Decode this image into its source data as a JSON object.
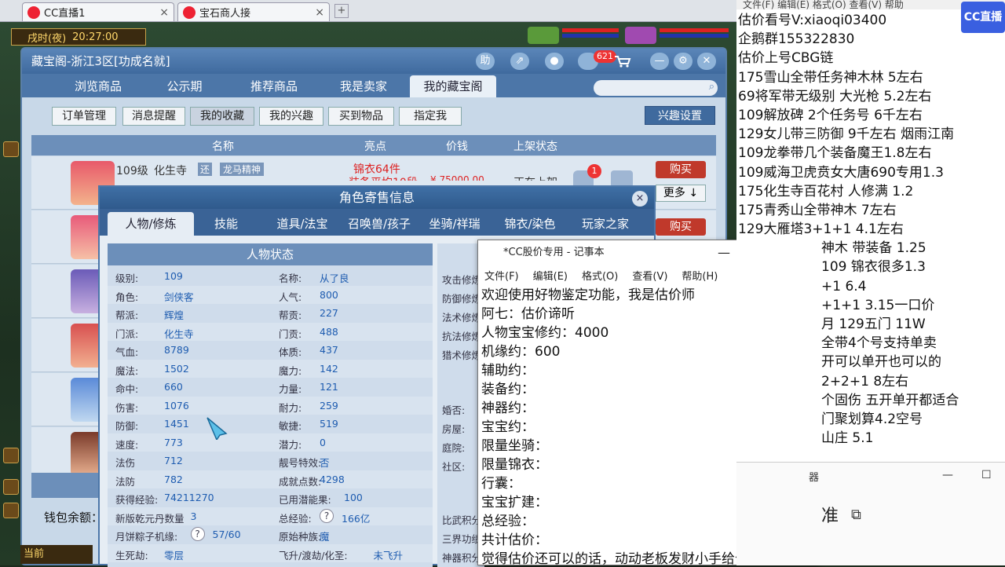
{
  "browser": {
    "tabs": [
      {
        "label": "CC直播1",
        "close": "×"
      },
      {
        "label": "宝石商人接",
        "close": "×"
      }
    ],
    "new_tab": "+"
  },
  "game": {
    "time_label": "戌时(夜)",
    "clock": "20:27:00",
    "bottom_label": "当前"
  },
  "treasure_window": {
    "title": "藏宝阁-浙江3区[功成名就]",
    "title_buttons": [
      "助",
      "⇗",
      "●"
    ],
    "message_badge": "621",
    "tabs": [
      "浏览商品",
      "公示期",
      "推荐商品",
      "我是卖家",
      "我的藏宝阁"
    ],
    "sub_buttons": [
      "订单管理",
      "消息提醒",
      "我的收藏",
      "我的兴趣",
      "买到物品",
      "指定我"
    ],
    "interest_button": "兴趣设置",
    "list_headers": [
      "名称",
      "亮点",
      "价钱",
      "上架状态"
    ],
    "first_row": {
      "level": "109级",
      "school": "化生寺",
      "tag1": "还",
      "tag2": "龙马精神",
      "highlight": "锦衣64件",
      "highlight2": "装备平均10段",
      "price": "¥ 75000.00",
      "status": "正在上架",
      "badge": "1"
    },
    "buy_label": "购买",
    "more_label": "更多 ↓",
    "wallet_label": "钱包余额："
  },
  "char_dialog": {
    "title": "角色寄售信息",
    "close": "×",
    "tabs": [
      "人物/修炼",
      "技能",
      "道具/法宝",
      "召唤兽/孩子",
      "坐骑/祥瑞",
      "锦衣/染色",
      "玩家之家"
    ],
    "stat_title": "人物状态",
    "stats": [
      [
        {
          "label": "级别:",
          "value": "109"
        },
        {
          "label": "名称:",
          "value": "从了良"
        }
      ],
      [
        {
          "label": "角色:",
          "value": "剑侠客"
        },
        {
          "label": "人气:",
          "value": "800"
        }
      ],
      [
        {
          "label": "帮派:",
          "value": "辉煌"
        },
        {
          "label": "帮贡:",
          "value": "227"
        }
      ],
      [
        {
          "label": "门派:",
          "value": "化生寺"
        },
        {
          "label": "门贡:",
          "value": "488"
        }
      ],
      [
        {
          "label": "气血:",
          "value": "8789"
        },
        {
          "label": "体质:",
          "value": "437"
        }
      ],
      [
        {
          "label": "魔法:",
          "value": "1502"
        },
        {
          "label": "魔力:",
          "value": "142"
        }
      ],
      [
        {
          "label": "命中:",
          "value": "660"
        },
        {
          "label": "力量:",
          "value": "121"
        }
      ],
      [
        {
          "label": "伤害:",
          "value": "1076"
        },
        {
          "label": "耐力:",
          "value": "259"
        }
      ],
      [
        {
          "label": "防御:",
          "value": "1451"
        },
        {
          "label": "敏捷:",
          "value": "519"
        }
      ],
      [
        {
          "label": "速度:",
          "value": "773"
        },
        {
          "label": "潜力:",
          "value": "0"
        }
      ],
      [
        {
          "label": "法伤",
          "value": "712"
        },
        {
          "label": "靓号特效:",
          "value": "否"
        }
      ],
      [
        {
          "label": "法防",
          "value": "782"
        },
        {
          "label": "成就点数:",
          "value": "4298"
        }
      ],
      [
        {
          "label": "获得经验:",
          "value": "74211270"
        },
        {
          "label": "已用潜能果:",
          "value": "100"
        }
      ],
      [
        {
          "label": "新版乾元丹数量",
          "value": "3"
        },
        {
          "label": "总经验:",
          "value": "166亿"
        }
      ],
      [
        {
          "label": "月饼粽子机缘:",
          "value": "57/60"
        },
        {
          "label": "原始种族:",
          "value": "魔"
        }
      ],
      [
        {
          "label": "生死劫:",
          "value": "零层"
        },
        {
          "label": "飞升/渡劫/化圣:",
          "value": "未飞升"
        }
      ]
    ],
    "side_labels": [
      "攻击修炼",
      "防御修炼",
      "法术修炼",
      "抗法修炼",
      "猎术修炼",
      "婚否:",
      "房屋:",
      "庭院:",
      "社区:",
      "比武积分",
      "三界功绩",
      "神器积分"
    ]
  },
  "notepad": {
    "title": "*CC股价专用 - 记事本",
    "min": "—",
    "max": "☐",
    "close": "✕",
    "menu": [
      "文件(F)",
      "编辑(E)",
      "格式(O)",
      "查看(V)",
      "帮助(H)"
    ],
    "lines": [
      "欢迎使用好物鉴定功能，我是估价师",
      "阿七：估价谛听",
      "人物宝宝修约：4000",
      "机缘约：600",
      "辅助约：",
      "装备约：",
      "神器约：",
      "宝宝约：",
      "限量坐骑：",
      "限量锦衣：",
      "行囊：",
      "宝宝扩建：",
      "总经验：",
      "共计估价：",
      "觉得估价还可以的话，动动老板发财小手给个好评"
    ]
  },
  "right_panel": {
    "menu_partial": "文件(F)   编辑(E)   格式(O)   查看(V)   帮助",
    "logo": "CC直播",
    "lines": [
      "估价看号V:xiaoqi03400",
      "企鹅群155322830",
      "估价上号CBG链",
      "175雪山全带任务神木林 5左右",
      "69将军带无级别 大光枪 5.2左右",
      "109解放碑 2个任务号 6千左右",
      "129女儿带三防御 9千左右 烟雨江南",
      "109龙拳带几个装备魔王1.8左右",
      "109威海卫虎贲女大唐690专用1.3",
      "175化生寺百花村 人修满 1.2",
      "175青秀山全带神木  7左右",
      "129大雁塔3+1+1  4.1左右",
      "神木 带装备  1.25",
      "109  锦衣很多1.3",
      "+1  6.4",
      "+1+1   3.15一口价",
      "月 129五门 11W",
      "全带4个号支持单卖",
      "开可以单开也可以的",
      "2+2+1 8左右",
      "个固伤 五开单开都适合",
      "门聚划算4.2空号",
      "山庄  5.1"
    ],
    "bottom_text": "准",
    "bottom_icon_label": "器"
  }
}
